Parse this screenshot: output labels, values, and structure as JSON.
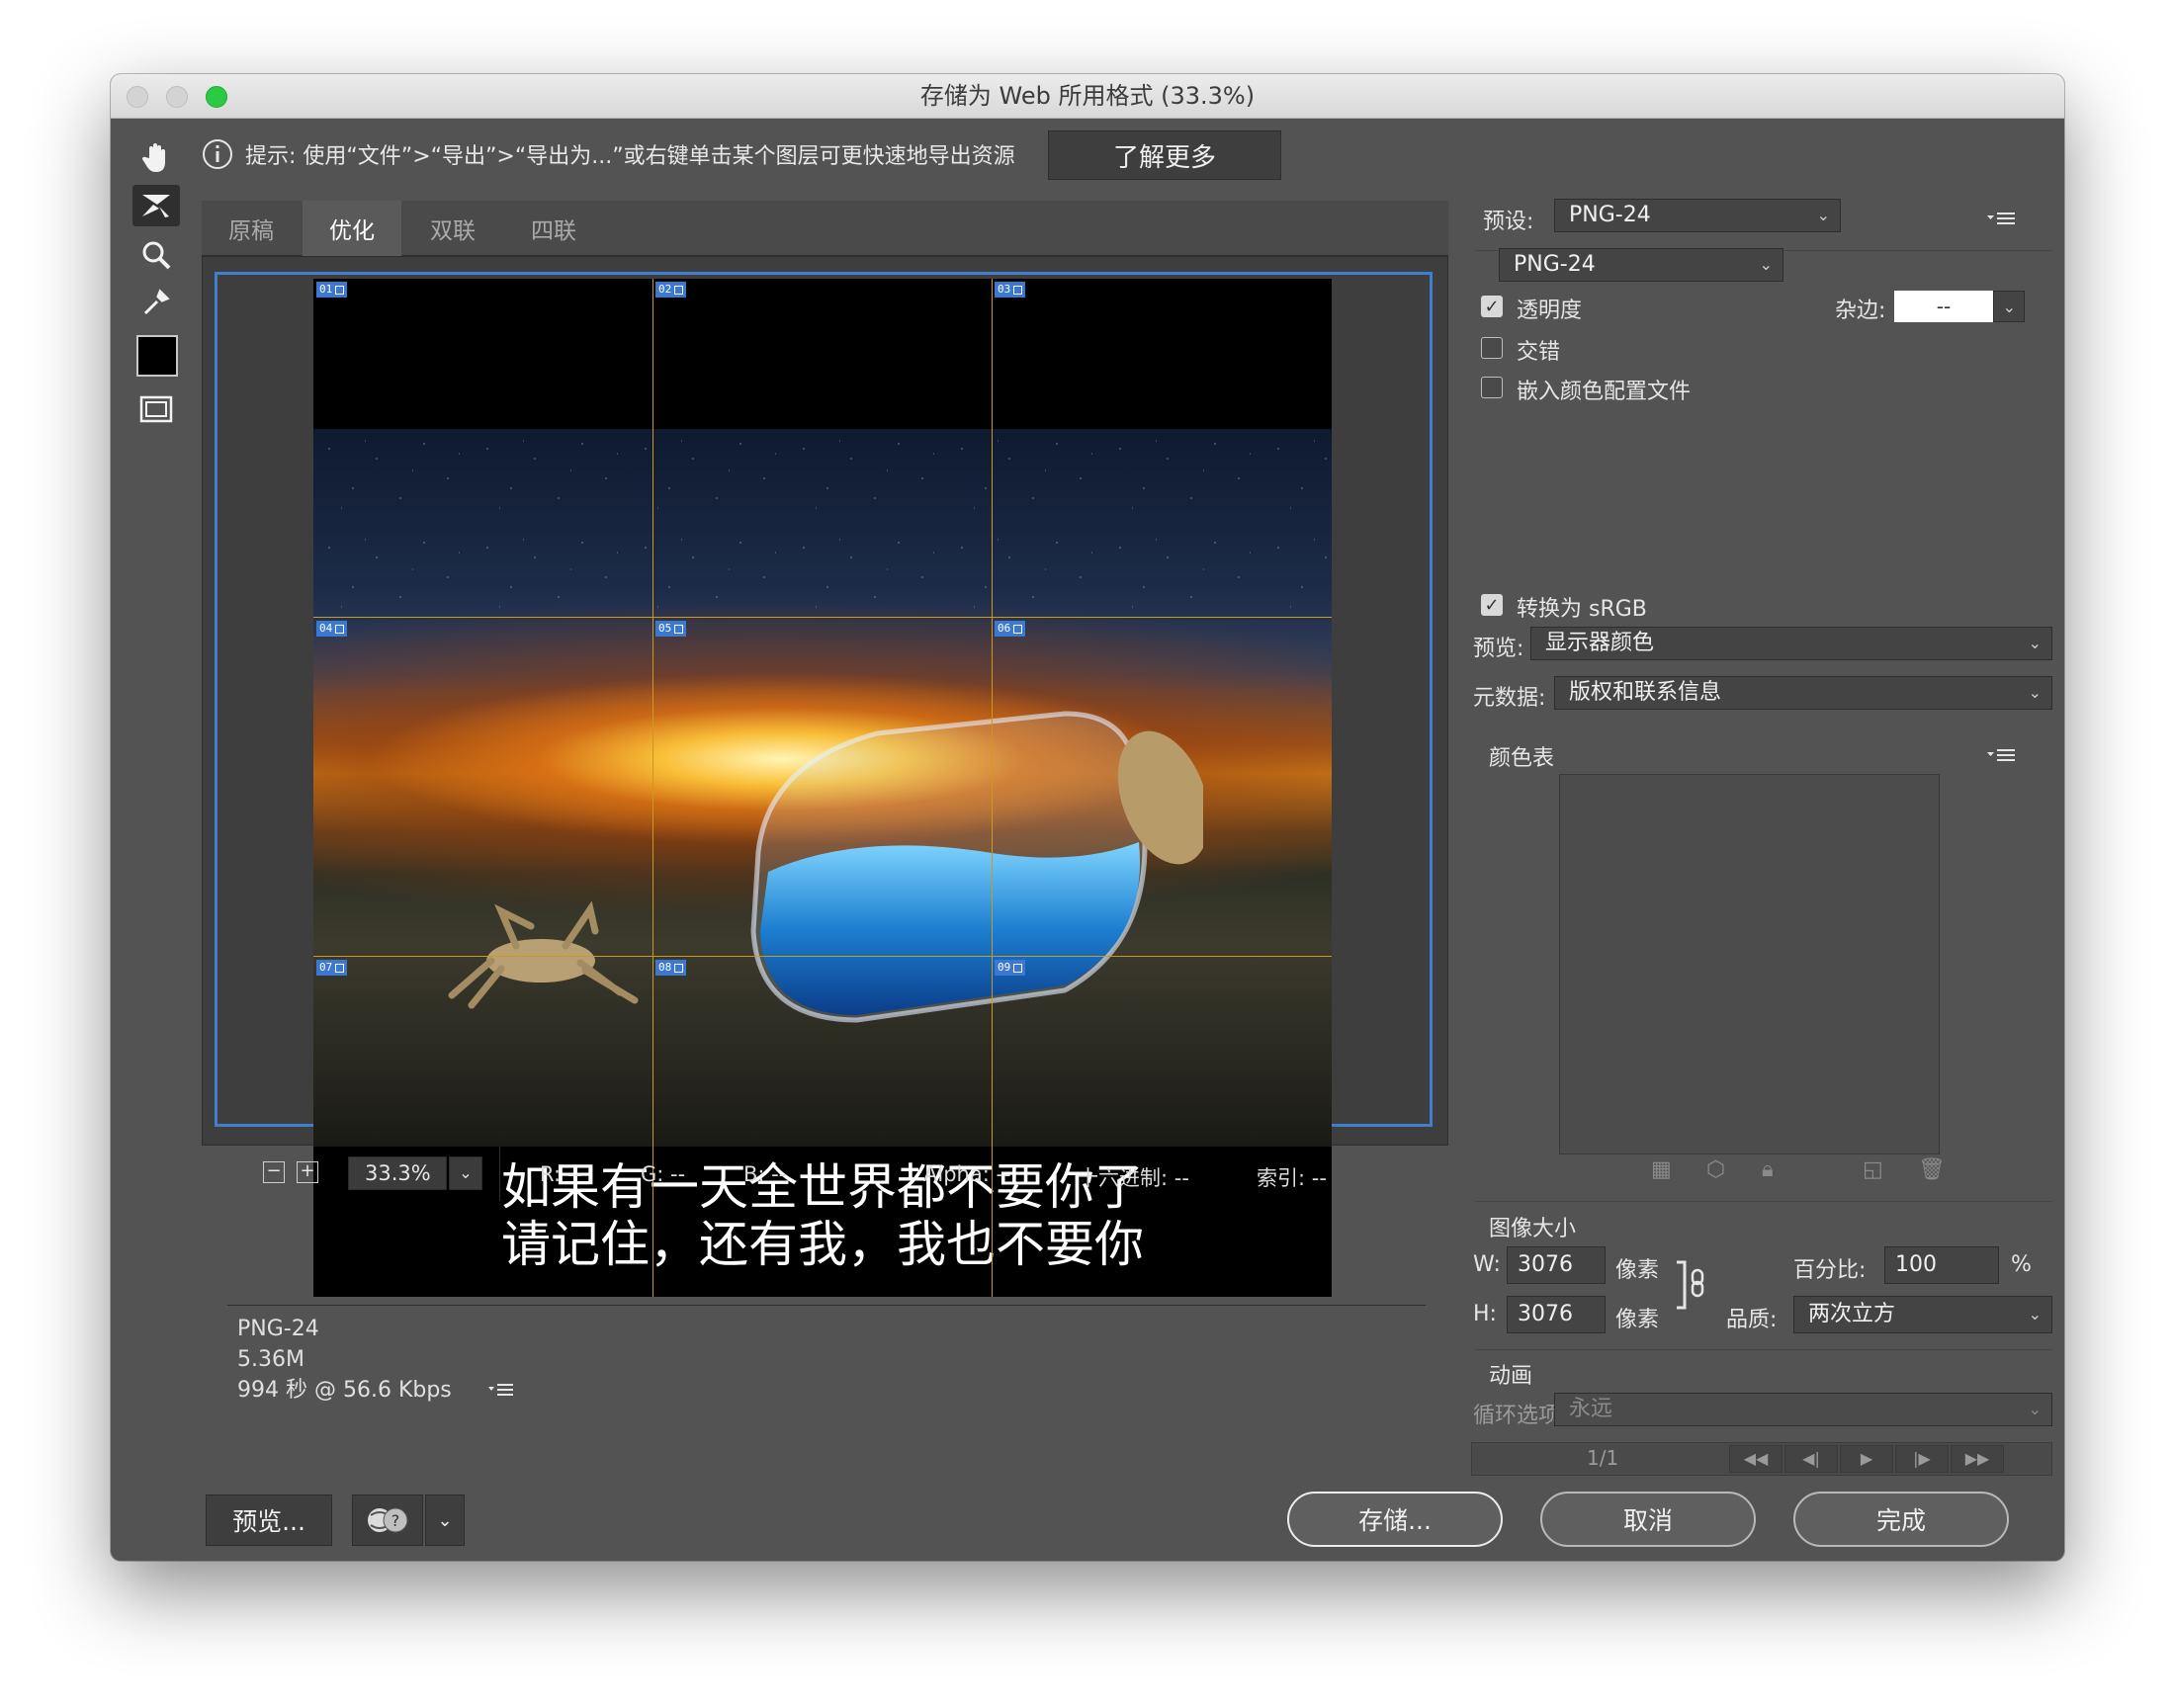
{
  "window": {
    "title": "存储为 Web 所用格式 (33.3%)"
  },
  "hint": {
    "text": "提示: 使用“文件”>“导出”>“导出为...”或右键单击某个图层可更快速地导出资源",
    "learn_more": "了解更多"
  },
  "tabs": [
    "原稿",
    "优化",
    "双联",
    "四联"
  ],
  "image": {
    "caption_line1": "如果有一天全世界都不要你了",
    "caption_line2": "请记住，还有我，我也不要你"
  },
  "slices": [
    "01",
    "02",
    "03",
    "04",
    "05",
    "06",
    "07",
    "08",
    "09"
  ],
  "info": {
    "format": "PNG-24",
    "size": "5.36M",
    "time": "994 秒 @ 56.6 Kbps"
  },
  "status": {
    "zoom": "33.3%",
    "r": "R: --",
    "g": "G: --",
    "b": "B: --",
    "alpha": "Alpha: --",
    "hex": "十六进制: --",
    "index": "索引: --"
  },
  "buttons": {
    "preview": "预览...",
    "save": "存储...",
    "cancel": "取消",
    "done": "完成"
  },
  "settings": {
    "preset_label": "预设:",
    "preset_value": "PNG-24",
    "format_value": "PNG-24",
    "transparency": "透明度",
    "matte_label": "杂边:",
    "matte_value": "--",
    "interlaced": "交错",
    "embed_profile": "嵌入颜色配置文件",
    "convert_srgb": "转换为 sRGB",
    "preview_label": "预览:",
    "preview_value": "显示器颜色",
    "metadata_label": "元数据:",
    "metadata_value": "版权和联系信息",
    "color_table": "颜色表"
  },
  "image_size": {
    "title": "图像大小",
    "w_label": "W:",
    "w_value": "3076",
    "w_unit": "像素",
    "h_label": "H:",
    "h_value": "3076",
    "h_unit": "像素",
    "percent_label": "百分比:",
    "percent_value": "100",
    "percent_unit": "%",
    "quality_label": "品质:",
    "quality_value": "两次立方"
  },
  "animation": {
    "title": "动画",
    "loop_label": "循环选项:",
    "loop_value": "永远",
    "frame": "1/1"
  }
}
